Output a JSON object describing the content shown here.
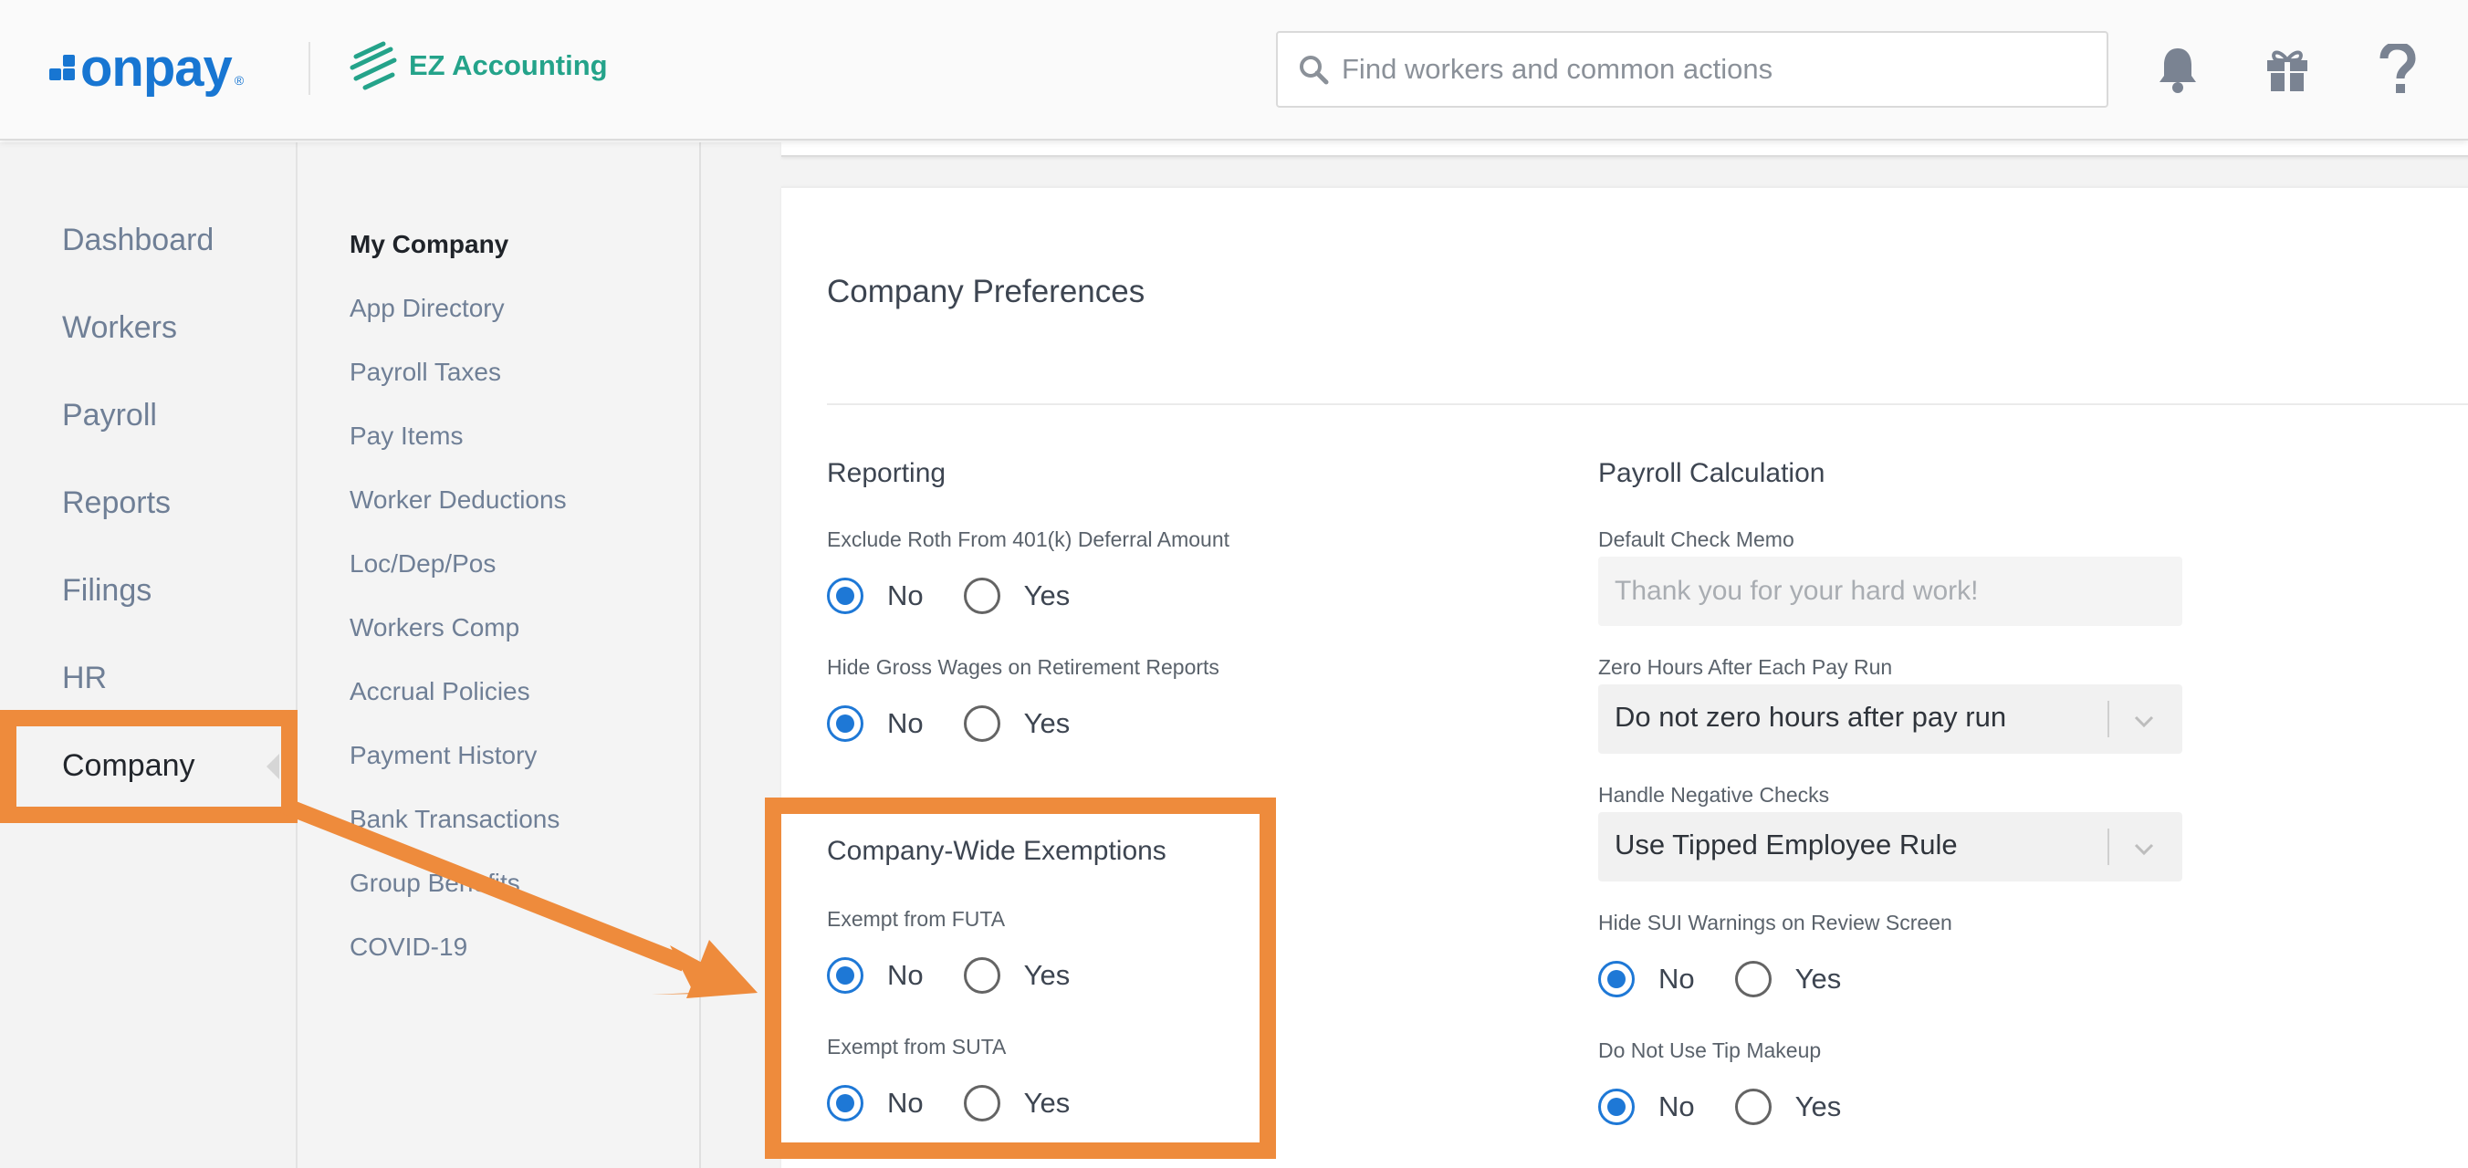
{
  "header": {
    "brand": "onpay",
    "brand_mark": "®",
    "partner": "EZ Accounting",
    "search_placeholder": "Find workers and common actions"
  },
  "main_nav": {
    "items": [
      {
        "label": "Dashboard"
      },
      {
        "label": "Workers"
      },
      {
        "label": "Payroll"
      },
      {
        "label": "Reports"
      },
      {
        "label": "Filings"
      },
      {
        "label": "HR"
      },
      {
        "label": "Company",
        "active": true
      }
    ]
  },
  "sub_nav": {
    "items": [
      {
        "label": "My Company",
        "active": true
      },
      {
        "label": "App Directory"
      },
      {
        "label": "Payroll Taxes"
      },
      {
        "label": "Pay Items"
      },
      {
        "label": "Worker Deductions"
      },
      {
        "label": "Loc/Dep/Pos"
      },
      {
        "label": "Workers Comp"
      },
      {
        "label": "Accrual Policies"
      },
      {
        "label": "Payment History"
      },
      {
        "label": "Bank Transactions"
      },
      {
        "label": "Group Benefits"
      },
      {
        "label": "COVID-19"
      }
    ]
  },
  "preferences": {
    "title": "Company Preferences",
    "reporting": {
      "title": "Reporting",
      "fields": [
        {
          "label": "Exclude Roth From 401(k) Deferral Amount",
          "options": [
            "No",
            "Yes"
          ],
          "selected": "No"
        },
        {
          "label": "Hide Gross Wages on Retirement Reports",
          "options": [
            "No",
            "Yes"
          ],
          "selected": "No"
        }
      ]
    },
    "exemptions": {
      "title": "Company-Wide Exemptions",
      "fields": [
        {
          "label": "Exempt from FUTA",
          "options": [
            "No",
            "Yes"
          ],
          "selected": "No"
        },
        {
          "label": "Exempt from SUTA",
          "options": [
            "No",
            "Yes"
          ],
          "selected": "No"
        }
      ]
    },
    "payroll_calc": {
      "title": "Payroll Calculation",
      "default_check_memo": {
        "label": "Default Check Memo",
        "value": "",
        "placeholder": "Thank you for your hard work!"
      },
      "zero_hours": {
        "label": "Zero Hours After Each Pay Run",
        "value": "Do not zero hours after pay run"
      },
      "negative_checks": {
        "label": "Handle Negative Checks",
        "value": "Use Tipped Employee Rule"
      },
      "hide_sui": {
        "label": "Hide SUI Warnings on Review Screen",
        "options": [
          "No",
          "Yes"
        ],
        "selected": "No"
      },
      "tip_makeup": {
        "label": "Do Not Use Tip Makeup",
        "options": [
          "No",
          "Yes"
        ],
        "selected": "No"
      }
    }
  },
  "colors": {
    "accent": "#1e78d6",
    "brand": "#1876d2",
    "annotation": "#ee8b3c",
    "partner": "#24a38a"
  }
}
